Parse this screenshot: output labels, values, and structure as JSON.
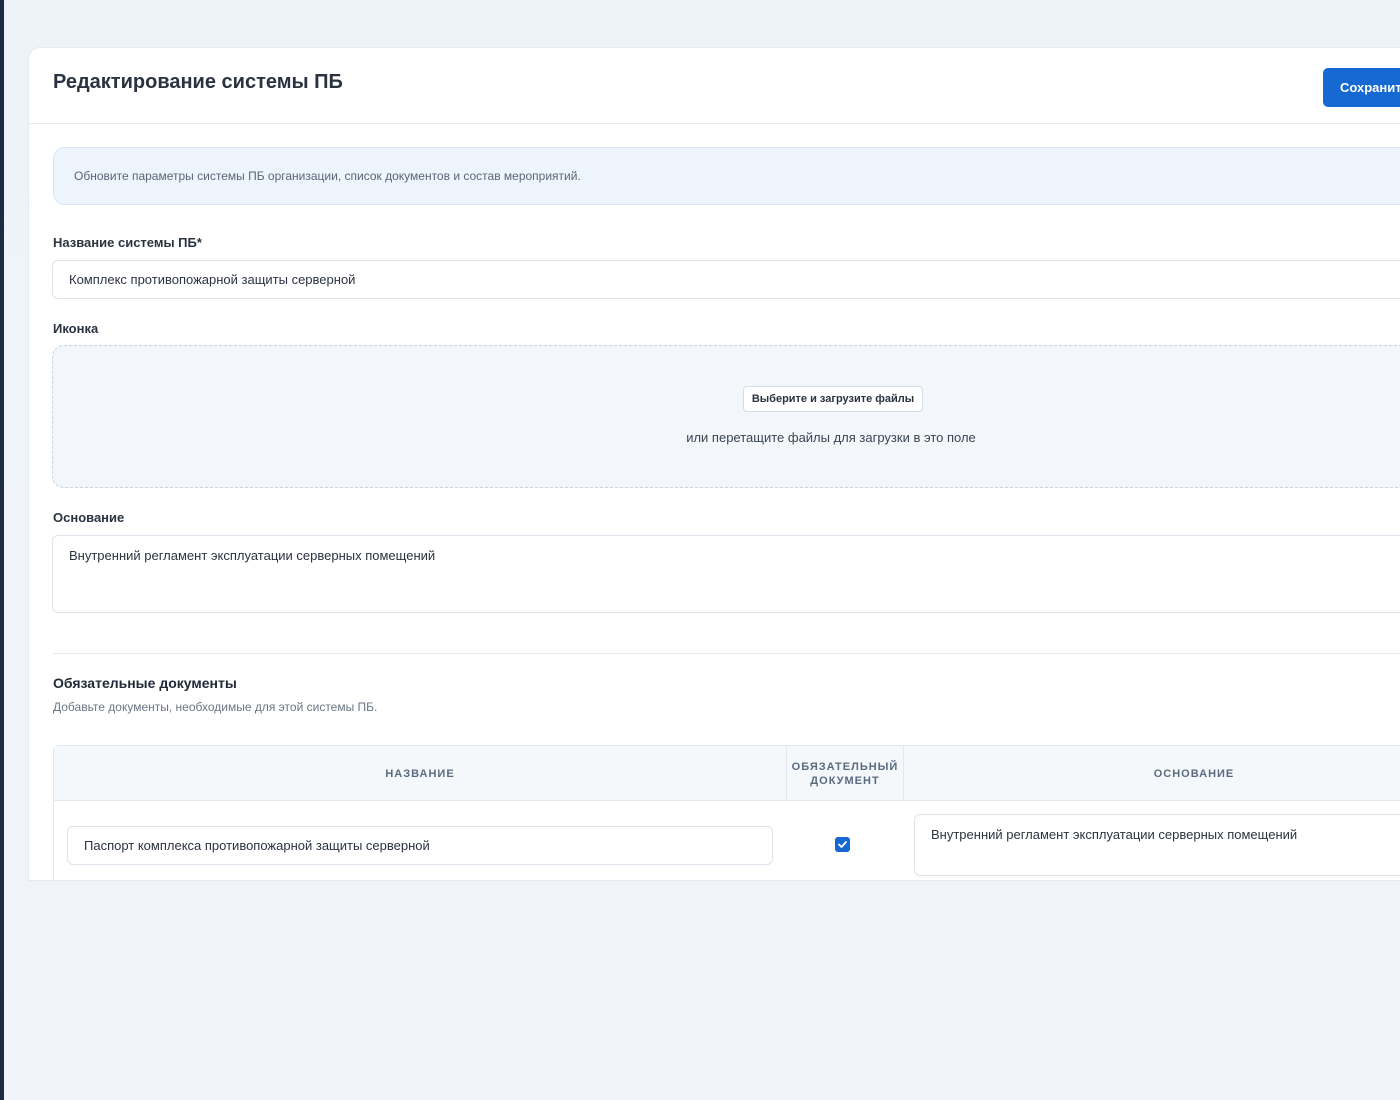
{
  "header": {
    "title": "Редактирование системы ПБ",
    "save_label": "Сохранить"
  },
  "info": {
    "text": "Обновите параметры системы ПБ организации, список документов и состав мероприятий."
  },
  "form": {
    "name_label": "Название системы ПБ*",
    "name_value": "Комплекс противопожарной защиты серверной",
    "icon_label": "Иконка",
    "upload_button": "Выберите и загрузите файлы",
    "drop_hint": "или перетащите файлы для загрузки в это поле",
    "basis_label": "Основание",
    "basis_value": "Внутренний регламент эксплуатации серверных помещений"
  },
  "documents": {
    "title": "Обязательные документы",
    "subtitle": "Добавьте документы, необходимые для этой системы ПБ.",
    "columns": [
      "НАЗВАНИЕ",
      "ОБЯЗАТЕЛЬНЫЙ ДОКУМЕНТ",
      "ОСНОВАНИЕ"
    ],
    "rows": [
      {
        "name": "Паспорт комплекса противопожарной защиты серверной",
        "required": true,
        "basis": "Внутренний регламент эксплуатации серверных помещений"
      }
    ]
  },
  "colors": {
    "accent": "#1668d2",
    "info_bg": "#eef4fb"
  }
}
